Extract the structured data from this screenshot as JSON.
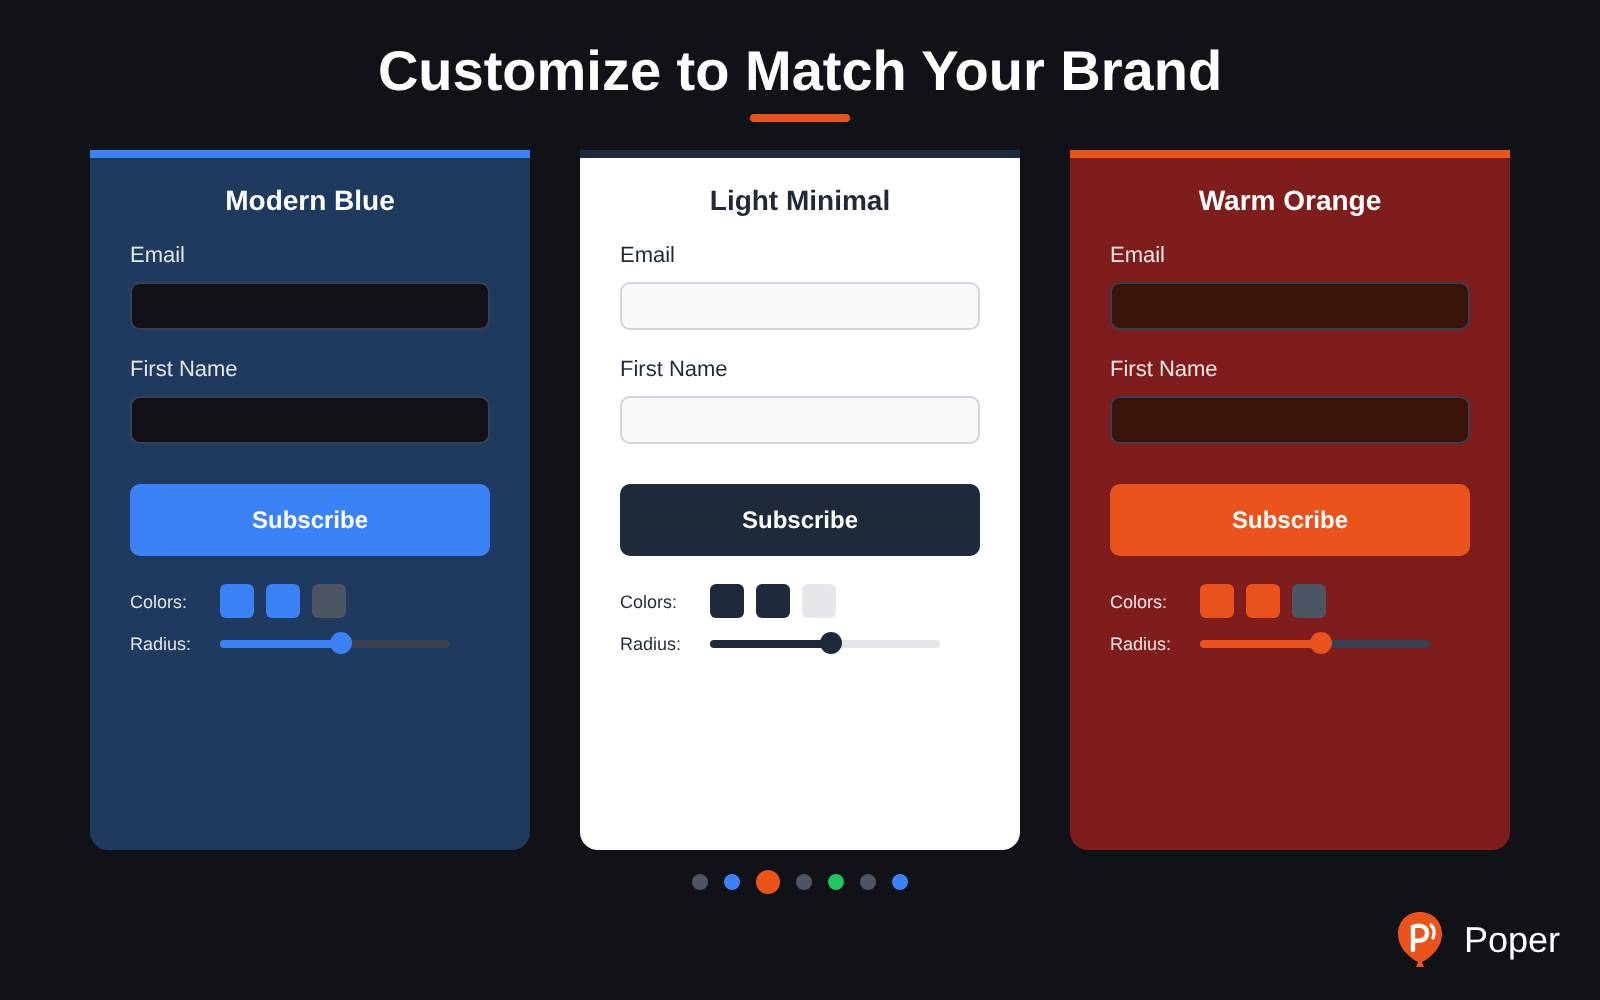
{
  "heading": "Customize to Match Your Brand",
  "cards": [
    {
      "kind": "blue",
      "title": "Modern Blue",
      "fields": [
        {
          "label": "Email"
        },
        {
          "label": "First Name"
        }
      ],
      "button": "Subscribe",
      "colors_label": "Colors:",
      "swatches": [
        {
          "color": "#3b82f6"
        },
        {
          "color": "#3b82f6"
        },
        {
          "color": "#4b5563"
        }
      ],
      "radius_label": "Radius:",
      "radius": {
        "level": 0.53
      }
    },
    {
      "kind": "light",
      "title": "Light Minimal",
      "fields": [
        {
          "label": "Email"
        },
        {
          "label": "First Name"
        }
      ],
      "button": "Subscribe",
      "colors_label": "Colors:",
      "swatches": [
        {
          "color": "#1e293b"
        },
        {
          "color": "#1e293b"
        },
        {
          "color": "#e5e7eb"
        }
      ],
      "radius_label": "Radius:",
      "radius": {
        "level": 0.53
      }
    },
    {
      "kind": "orange",
      "title": "Warm Orange",
      "fields": [
        {
          "label": "Email"
        },
        {
          "label": "First Name"
        }
      ],
      "button": "Subscribe",
      "colors_label": "Colors:",
      "swatches": [
        {
          "color": "#ea531c"
        },
        {
          "color": "#ea531c"
        },
        {
          "color": "#4b5563"
        }
      ],
      "radius_label": "Radius:",
      "radius": {
        "level": 0.53
      }
    }
  ],
  "pager": [
    {
      "color": "#4b5563",
      "selected": false
    },
    {
      "color": "#3b82f6",
      "selected": false
    },
    {
      "color": "#ea531c",
      "selected": true
    },
    {
      "color": "#4b5563",
      "selected": false
    },
    {
      "color": "#22c55e",
      "selected": false
    },
    {
      "color": "#4b5563",
      "selected": false
    },
    {
      "color": "#3b82f6",
      "selected": false
    }
  ],
  "brand": "Poper"
}
